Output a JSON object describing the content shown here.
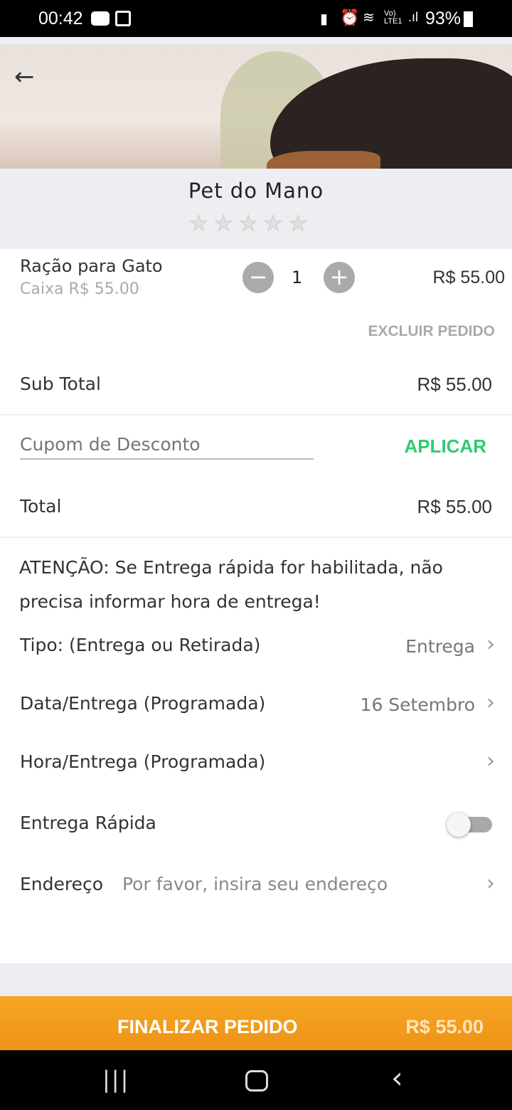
{
  "status_bar": {
    "time": "00:42",
    "network": "Vo) LTE1",
    "battery": "93%"
  },
  "header": {
    "store_name": "Pet do Mano",
    "rating": 0,
    "max_rating": 5
  },
  "item": {
    "name": "Ração para Gato",
    "unit": "Caixa R$ 55.00",
    "quantity": "1",
    "price": "R$ 55.00",
    "delete_label": "EXCLUIR PEDIDO"
  },
  "subtotal": {
    "label": "Sub Total",
    "value": "R$ 55.00"
  },
  "coupon": {
    "placeholder": "Cupom de Desconto",
    "apply_label": "APLICAR"
  },
  "total": {
    "label": "Total",
    "value": "R$ 55.00"
  },
  "notice": "ATENÇÃO: Se Entrega rápida for habilitada, não precisa informar hora de entrega!",
  "options": {
    "type": {
      "label": "Tipo: (Entrega ou Retirada)",
      "value": "Entrega"
    },
    "date": {
      "label": "Data/Entrega (Programada)",
      "value": "16 Setembro"
    },
    "hour": {
      "label": "Hora/Entrega (Programada)",
      "value": ""
    },
    "fast": {
      "label": "Entrega Rápida",
      "enabled": false
    },
    "address": {
      "label": "Endereço",
      "placeholder": "Por favor, insira seu endereço"
    }
  },
  "footer": {
    "checkout_label": "FINALIZAR PEDIDO",
    "checkout_total": "R$ 55.00"
  },
  "colors": {
    "accent_green": "#2ecc71",
    "checkout_orange": "#f39c1e"
  }
}
